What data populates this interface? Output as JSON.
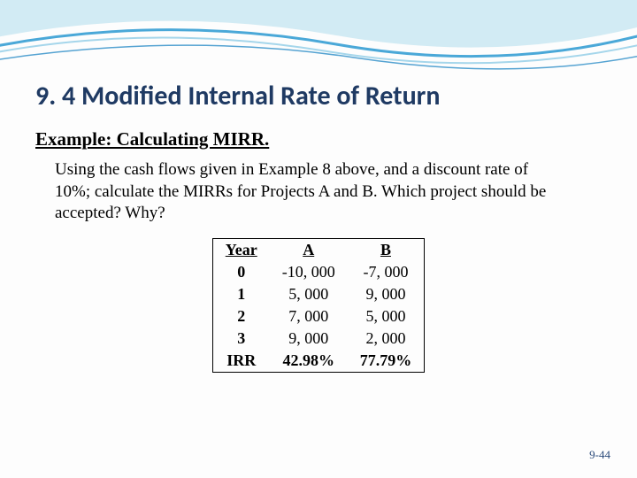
{
  "title": "9. 4 Modified Internal Rate of Return",
  "subtitle": "Example:  Calculating MIRR.",
  "body": "Using the cash flows given in Example 8 above, and a discount rate of 10%; calculate the MIRRs for Projects A and B.  Which project should be accepted? Why?",
  "table": {
    "headers": [
      "Year",
      "A",
      "B"
    ],
    "rows": [
      {
        "label": "0",
        "a": "-10, 000",
        "b": "-7, 000"
      },
      {
        "label": "1",
        "a": "5, 000",
        "b": "9, 000"
      },
      {
        "label": "2",
        "a": "7, 000",
        "b": "5, 000"
      },
      {
        "label": "3",
        "a": "9, 000",
        "b": "2, 000"
      },
      {
        "label": "IRR",
        "a": "42.98%",
        "b": "77.79%"
      }
    ]
  },
  "slide_number": "9-44"
}
